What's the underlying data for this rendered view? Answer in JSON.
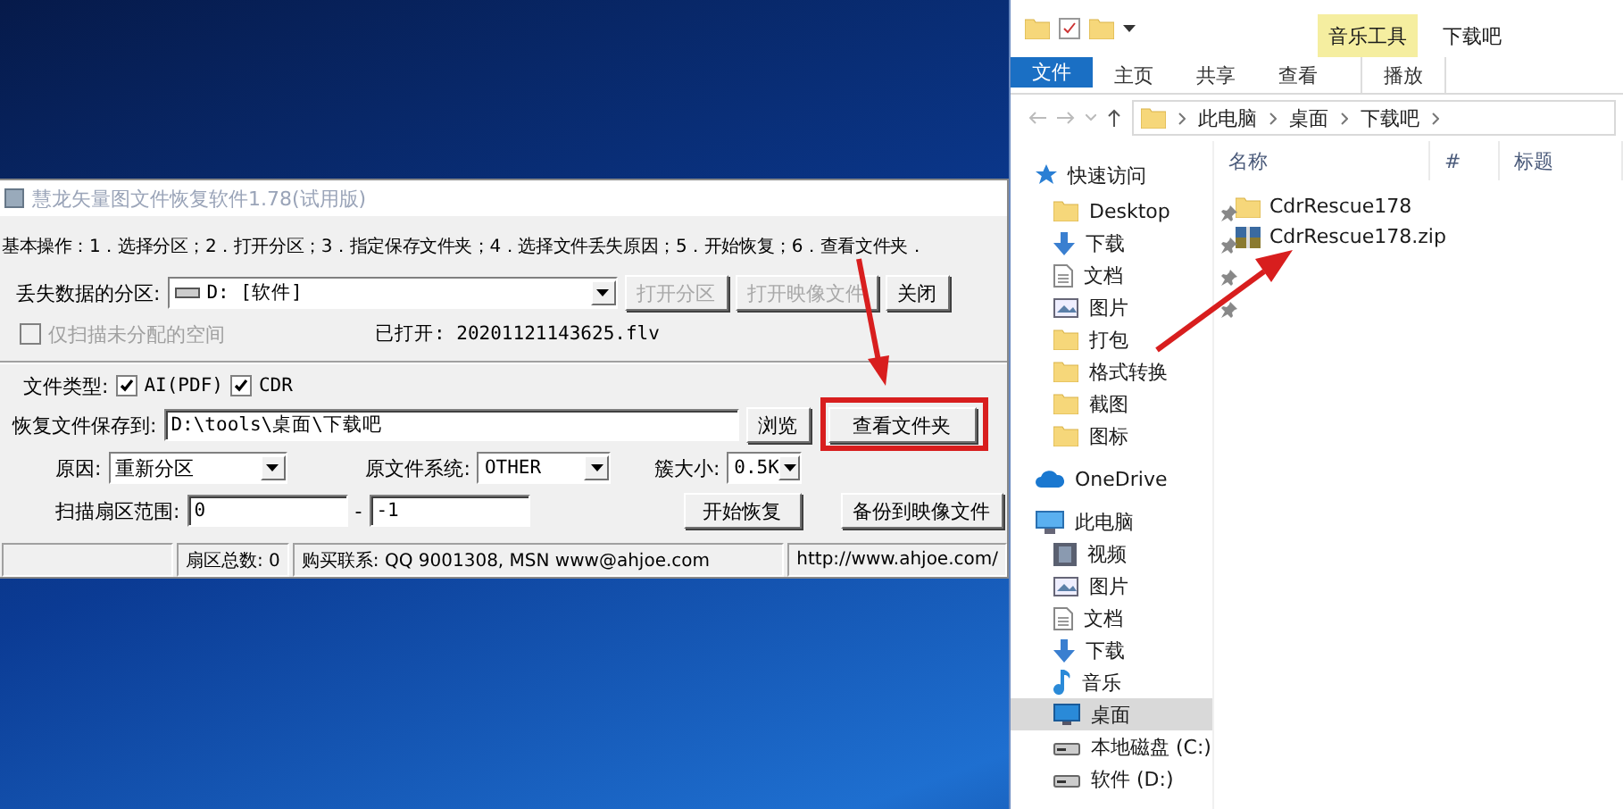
{
  "recovery_window": {
    "title": "慧龙矢量图文件恢复软件1.78(试用版)",
    "instructions": "基本操作：1．选择分区；2．打开分区；3．指定保存文件夹；4．选择文件丢失原因；5．开始恢复；6．查看文件夹．",
    "partition_label": "丢失数据的分区:",
    "partition_value": "D: [软件]",
    "partition_buttons": [
      {
        "label": "打开分区",
        "disabled": true
      },
      {
        "label": "打开映像文件",
        "disabled": true
      },
      {
        "label": "关闭",
        "disabled": false
      }
    ],
    "unallocated_only": {
      "label": "仅扫描未分配的空间",
      "checked": false,
      "disabled": true
    },
    "opened_file": "已打开: 20201121143625.flv",
    "file_type_label": "文件类型:",
    "file_types": [
      {
        "label": "AI(PDF)",
        "checked": true
      },
      {
        "label": "CDR",
        "checked": true
      }
    ],
    "save_label": "恢复文件保存到:",
    "save_path": "D:\\tools\\桌面\\下载吧",
    "browse_button": "浏览",
    "view_folder_button": "查看文件夹",
    "reason_label": "原因:",
    "reason_value": "重新分区",
    "fs_label": "原文件系统:",
    "fs_value": "OTHER",
    "cluster_label": "簇大小:",
    "cluster_value": "0.5K",
    "range_label": "扫描扇区范围:",
    "range_start": "0",
    "range_separator": "-",
    "range_end": "-1",
    "start_button": "开始恢复",
    "backup_button": "备份到映像文件",
    "status_bar": [
      "扇区总数: 0",
      "购买联系: QQ 9001308, MSN www@ahjoe.com",
      "http://www.ahjoe.com/"
    ]
  },
  "explorer": {
    "contextual_group": "音乐工具",
    "title": "下载吧",
    "ribbon_tabs": [
      {
        "label": "文件",
        "kind": "file"
      },
      {
        "label": "主页",
        "kind": "normal"
      },
      {
        "label": "共享",
        "kind": "normal"
      },
      {
        "label": "查看",
        "kind": "normal"
      },
      {
        "label": "播放",
        "kind": "contextual"
      }
    ],
    "breadcrumb": [
      "此电脑",
      "桌面",
      "下载吧"
    ],
    "columns": [
      "名称",
      "#",
      "标题"
    ],
    "nav_pane": [
      {
        "label": "快速访问",
        "selected": false,
        "children": [
          {
            "label": "Desktop",
            "pinned": true,
            "selected": false
          },
          {
            "label": "下载",
            "pinned": true,
            "selected": false
          },
          {
            "label": "文档",
            "pinned": true,
            "selected": false
          },
          {
            "label": "图片",
            "pinned": true,
            "selected": false
          },
          {
            "label": "打包",
            "pinned": false,
            "selected": false
          },
          {
            "label": "格式转换",
            "pinned": false,
            "selected": false
          },
          {
            "label": "截图",
            "pinned": false,
            "selected": false
          },
          {
            "label": "图标",
            "pinned": false,
            "selected": false
          }
        ]
      },
      {
        "label": "OneDrive",
        "selected": false
      },
      {
        "label": "此电脑",
        "selected": false,
        "children": [
          {
            "label": "视频",
            "selected": false
          },
          {
            "label": "图片",
            "selected": false
          },
          {
            "label": "文档",
            "selected": false
          },
          {
            "label": "下载",
            "selected": false
          },
          {
            "label": "音乐",
            "selected": false
          },
          {
            "label": "桌面",
            "selected": true
          },
          {
            "label": "本地磁盘 (C:)",
            "selected": false
          },
          {
            "label": "软件 (D:)",
            "selected": false
          }
        ]
      }
    ],
    "files": [
      {
        "name": "CdrRescue178",
        "kind": "folder"
      },
      {
        "name": "CdrRescue178.zip",
        "kind": "archive"
      }
    ]
  }
}
